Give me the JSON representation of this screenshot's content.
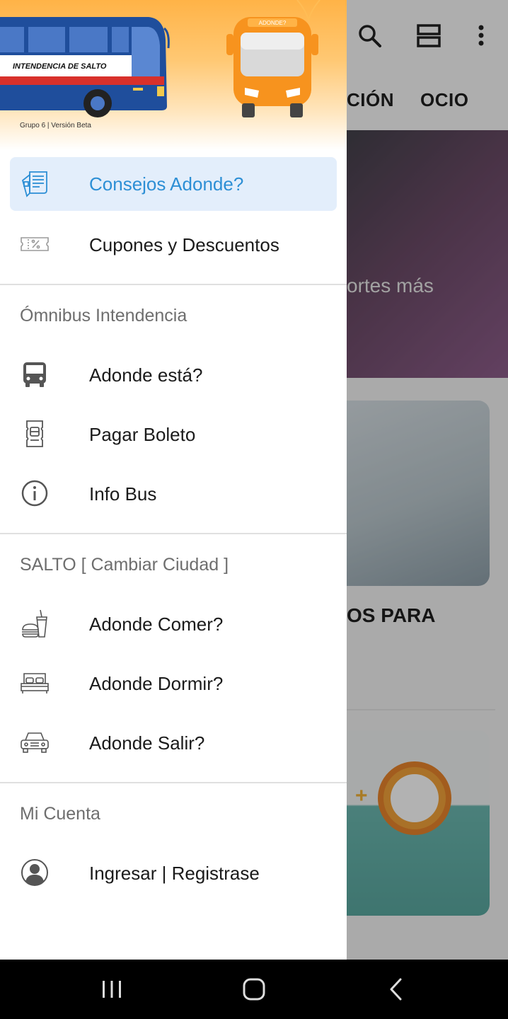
{
  "background_app": {
    "tabs": [
      "CIÓN",
      "OCIO"
    ],
    "hero_text": "ortes más",
    "card_text": "OS PARA",
    "toolbar_icons": [
      "search-icon",
      "view-agenda-icon",
      "more-vert-icon"
    ]
  },
  "header": {
    "bus_sign": "INTENDENCIA DE SALTO",
    "logo_sign": "ADONDE?",
    "caption": "Grupo 6 | Versión Beta"
  },
  "menu": {
    "top_items": [
      {
        "label": "Consejos Adonde?",
        "icon": "newspaper-icon",
        "active": true
      },
      {
        "label": "Cupones y Descuentos",
        "icon": "coupon-icon",
        "active": false
      }
    ],
    "sections": [
      {
        "title": "Ómnibus Intendencia",
        "items": [
          {
            "label": "Adonde está?",
            "icon": "bus-icon"
          },
          {
            "label": "Pagar Boleto",
            "icon": "ticket-icon"
          },
          {
            "label": "Info Bus",
            "icon": "info-icon"
          }
        ]
      },
      {
        "title": "SALTO [ Cambiar Ciudad ]",
        "items": [
          {
            "label": "Adonde Comer?",
            "icon": "fast-food-icon"
          },
          {
            "label": "Adonde Dormir?",
            "icon": "bed-icon"
          },
          {
            "label": "Adonde Salir?",
            "icon": "car-icon"
          }
        ]
      },
      {
        "title": "Mi Cuenta",
        "items": [
          {
            "label": "Ingresar | Registrase",
            "icon": "account-icon"
          }
        ]
      }
    ]
  },
  "colors": {
    "accent": "#2d8fd5",
    "active_bg": "#e3eefb",
    "header_orange": "#ffb347",
    "bus_blue": "#1f4e9c",
    "bus_red": "#d8312b"
  },
  "nav_bar": {
    "buttons": [
      "recent-apps-icon",
      "home-icon",
      "back-icon"
    ]
  }
}
